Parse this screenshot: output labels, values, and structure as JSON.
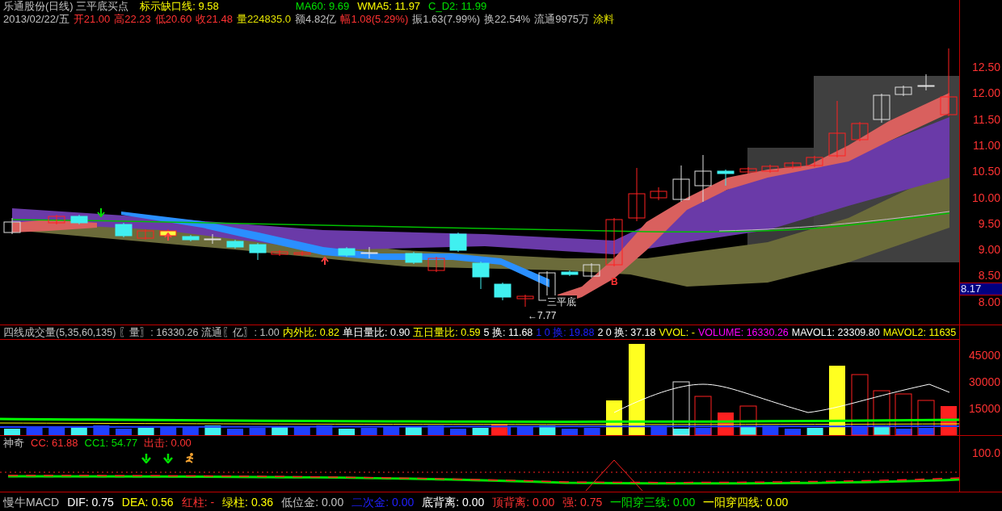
{
  "main_panel": {
    "title_line": [
      [
        {
          "text": "乐通股份(日线) 三平底买点",
          "color": "#c0c0c0"
        },
        {
          "text": "标示缺口线: 9.58",
          "color": "#ffff00"
        }
      ],
      [
        {
          "text": "MA60: 9.69",
          "color": "#00e000"
        },
        {
          "text": "WMA5: 11.97",
          "color": "#ffff00"
        },
        {
          "text": "C_D2: 11.99",
          "color": "#00e000"
        }
      ]
    ],
    "quote_line": [
      {
        "text": "2013/02/22/五",
        "color": "#c0c0c0"
      },
      {
        "text": "开21.00",
        "color": "#ff3232"
      },
      {
        "text": "高22.23",
        "color": "#ff3232"
      },
      {
        "text": "低20.60",
        "color": "#ff3232"
      },
      {
        "text": "收21.48",
        "color": "#ff3232"
      },
      {
        "text": "量224835.0",
        "color": "#e0e000"
      },
      {
        "text": "额4.82亿",
        "color": "#c0c0c0"
      },
      {
        "text": "幅1.08(5.29%)",
        "color": "#ff3232"
      },
      {
        "text": "振1.63(7.99%)",
        "color": "#c0c0c0"
      },
      {
        "text": "换22.54%",
        "color": "#c0c0c0"
      },
      {
        "text": "流通9975万",
        "color": "#c0c0c0"
      },
      {
        "text": "涂料",
        "color": "#e0e000"
      }
    ],
    "price_axis": [
      "12.50",
      "12.00",
      "11.50",
      "11.00",
      "10.50",
      "10.00",
      "9.50",
      "9.00",
      "8.50",
      "8.00"
    ],
    "current_price": "8.17",
    "annotations": [
      {
        "kind": "price",
        "text": "←7.77"
      },
      {
        "kind": "pattern",
        "text": "三平底"
      },
      {
        "kind": "signal",
        "text": "B"
      }
    ]
  },
  "volume_panel": {
    "header": [
      {
        "text": "四线成交量(5,35,60,135)",
        "color": "#c0c0c0"
      },
      {
        "text": "〖量〗: 16330.26",
        "color": "#c0c0c0"
      },
      {
        "text": "流通〖亿〗: 1.00",
        "color": "#c0c0c0"
      },
      {
        "text": "内外比: 0.82",
        "color": "#ffff00"
      },
      {
        "text": "单日量比: 0.90",
        "color": "#ffffff"
      },
      {
        "text": "五日量比: 0.59",
        "color": "#ffff00"
      },
      {
        "text": "5 换: 11.68",
        "color": "#ffffff"
      },
      {
        "text": "1 0 换: 19.88",
        "color": "#2020ff"
      },
      {
        "text": "2 0 换: 37.18",
        "color": "#ffffff"
      },
      {
        "text": "VVOL: -",
        "color": "#ffff00"
      },
      {
        "text": "VOLUME: 16330.26",
        "color": "#ff00ff"
      },
      {
        "text": "MAVOL1: 23309.80",
        "color": "#ffffff"
      },
      {
        "text": "MAVOL2: 11635",
        "color": "#ffff00"
      }
    ],
    "axis": [
      "45000",
      "30000",
      "15000"
    ]
  },
  "signal_panel": {
    "header": [
      {
        "text": "神奇",
        "color": "#c0c0c0"
      },
      {
        "text": "CC: 61.88",
        "color": "#ff3232"
      },
      {
        "text": "CC1: 54.77",
        "color": "#00e000"
      },
      {
        "text": "出击: 0.00",
        "color": "#ff3232"
      }
    ],
    "axis": [
      "100.0"
    ]
  },
  "macd_panel": {
    "header": [
      {
        "text": "慢牛MACD",
        "color": "#c0c0c0"
      },
      {
        "text": "DIF: 0.75",
        "color": "#ffffff"
      },
      {
        "text": "DEA: 0.56",
        "color": "#ffff00"
      },
      {
        "text": "红柱: -",
        "color": "#ff3232"
      },
      {
        "text": "绿柱: 0.36",
        "color": "#ffff00"
      },
      {
        "text": "低位金: 0.00",
        "color": "#c0c0c0"
      },
      {
        "text": "二次金: 0.00",
        "color": "#2020ff"
      },
      {
        "text": "底背离: 0.00",
        "color": "#ffffff"
      },
      {
        "text": "顶背离: 0.00",
        "color": "#ff3232"
      },
      {
        "text": "强: 0.75",
        "color": "#ff3232"
      },
      {
        "text": "一阳穿三线: 0.00",
        "color": "#00e000"
      },
      {
        "text": "一阳穿四线: 0.00",
        "color": "#ffff00"
      }
    ]
  }
}
